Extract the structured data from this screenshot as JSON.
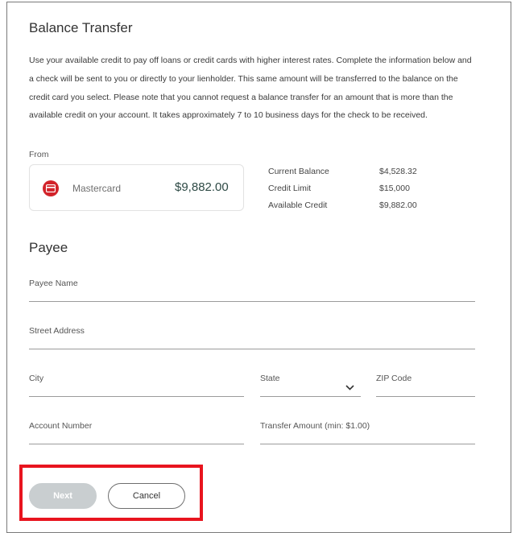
{
  "page": {
    "title": "Balance Transfer",
    "description": "Use your available credit to pay off loans or credit cards with higher interest rates. Complete the information below and a check will be sent to you or directly to your lienholder. This same amount will be transferred to the balance on the credit card you select. Please note that you cannot request a balance transfer for an amount that is more than the available credit on your account. It takes approximately 7 to 10 business days for the check to be received."
  },
  "from": {
    "label": "From",
    "card_name": "Mastercard",
    "card_amount": "$9,882.00",
    "card_icon": "credit-card-icon",
    "card_icon_color": "#d2232a",
    "details": [
      {
        "label": "Current Balance",
        "value": "$4,528.32"
      },
      {
        "label": "Credit Limit",
        "value": "$15,000"
      },
      {
        "label": "Available Credit",
        "value": "$9,882.00"
      }
    ]
  },
  "payee": {
    "title": "Payee",
    "name_label": "Payee Name",
    "street_label": "Street Address",
    "city_label": "City",
    "state_label": "State",
    "zip_label": "ZIP Code",
    "account_label": "Account Number",
    "amount_label": "Transfer Amount (min: $1.00)"
  },
  "buttons": {
    "next_label": "Next",
    "cancel_label": "Cancel"
  },
  "colors": {
    "highlight": "#e8141e",
    "next_disabled": "#c9ced0",
    "amount_text": "#2e4a45"
  }
}
